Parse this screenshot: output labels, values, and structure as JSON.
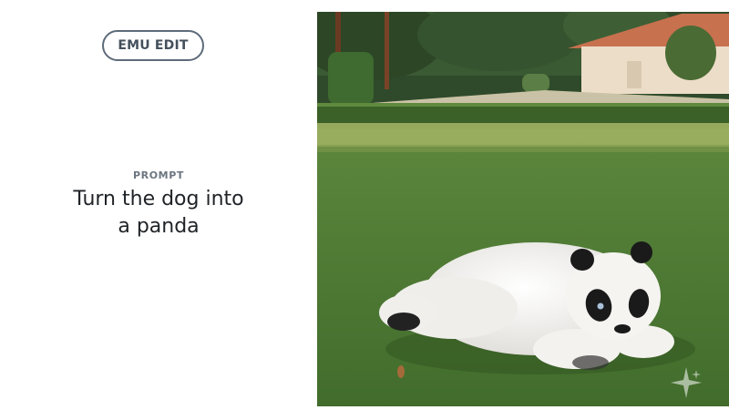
{
  "badge": {
    "label": "EMU EDIT"
  },
  "prompt": {
    "label": "PROMPT",
    "lines": [
      "Turn the dog into",
      "a panda"
    ]
  },
  "image": {
    "subject": "panda-on-lawn"
  },
  "colors": {
    "badge_border": "#5d6b7a",
    "badge_text": "#44505c",
    "prompt_label": "#6c7680",
    "prompt_text": "#1f2327",
    "grass": "#4c7a35",
    "panda_white": "#f2f1ee",
    "panda_black": "#1a1a1a"
  },
  "icons": {
    "watermark": "sparkle-icon"
  }
}
